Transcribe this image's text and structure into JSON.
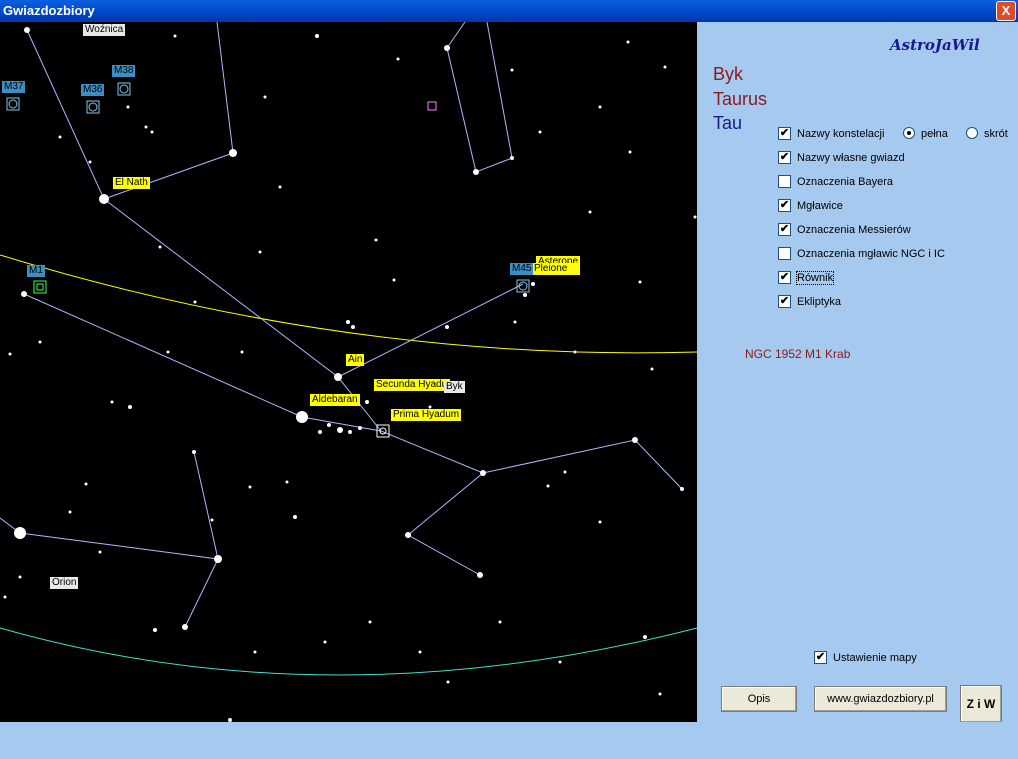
{
  "window": {
    "title": "Gwiazdozbiory",
    "close_symbol": "X"
  },
  "map": {
    "labels": {
      "woznica": "Woźnica",
      "m37": "M37",
      "m36": "M36",
      "m38": "M38",
      "el_nath": "El Nath",
      "m1": "M1",
      "m45": "M45",
      "asterope": "Asterope",
      "pleione": "Pleione",
      "ain": "Ain",
      "secunda_hyadum": "Secunda Hyadum",
      "byk": "Byk",
      "aldebaran": "Aldebaran",
      "prima_hyadum": "Prima Hyadum",
      "orion": "Orion"
    },
    "colors": {
      "background": "#000000",
      "lines": "#aab8ff",
      "ecliptic": "#ffff00",
      "equator": "#40e0d0"
    }
  },
  "panel": {
    "brand": "AstroJaWil",
    "constellation": {
      "polish": "Byk",
      "latin": "Taurus",
      "abbr": "Tau"
    },
    "options": {
      "nazwy_konstelacji": {
        "label": "Nazwy konstelacji",
        "checked": "✔"
      },
      "nazwy_wlasne": {
        "label": "Nazwy własne gwiazd",
        "checked": "✔"
      },
      "bayer": {
        "label": "Oznaczenia Bayera",
        "checked": ""
      },
      "mglawice": {
        "label": "Mgławice",
        "checked": "✔"
      },
      "messier": {
        "label": "Oznaczenia Messierów",
        "checked": "✔"
      },
      "ngc": {
        "label": "Oznaczenia mgławic NGC i IC",
        "checked": ""
      },
      "rownik": {
        "label": "Równik",
        "checked": "✔"
      },
      "ekliptyka": {
        "label": "Ekliptyka",
        "checked": "✔"
      },
      "ustawienie": {
        "label": "Ustawienie mapy",
        "checked": "✔"
      }
    },
    "radio": {
      "full": "pełna",
      "short": "skrót",
      "selected": "full"
    },
    "info_text": "NGC 1952 M1  Krab",
    "buttons": {
      "opis": "Opis",
      "www": "www.gwiazdozbiory.pl",
      "ziw": "Z i W"
    }
  }
}
